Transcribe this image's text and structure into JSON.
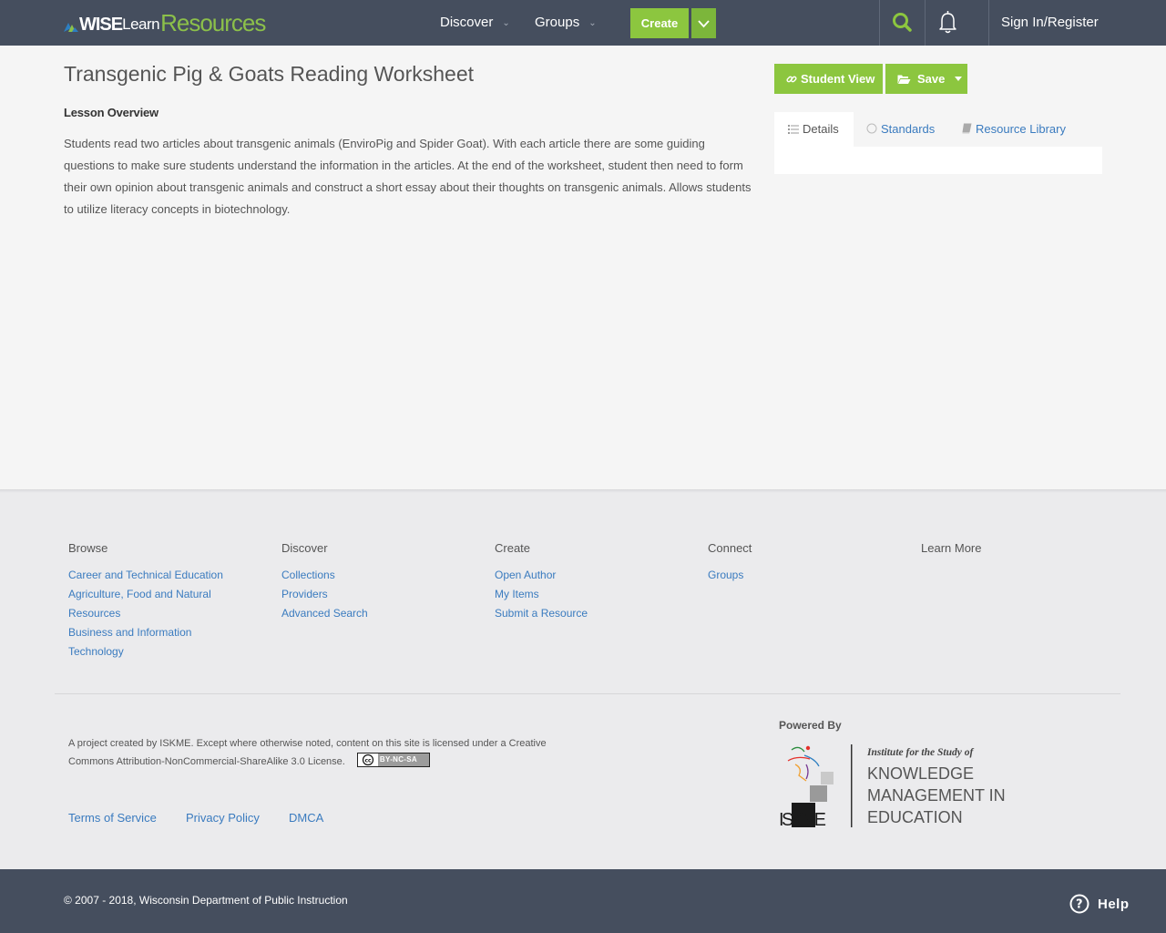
{
  "header": {
    "logo": {
      "part1": "WISE",
      "part2": "Learn",
      "part3": "Resources"
    },
    "nav": [
      {
        "label": "Discover"
      },
      {
        "label": "Groups"
      }
    ],
    "create_label": "Create",
    "signin_label": "Sign In/Register"
  },
  "resource": {
    "title": "Transgenic Pig & Goats Reading Worksheet",
    "overview_label": "Lesson Overview",
    "overview_text": "Students read two articles about transgenic animals (EnviroPig and Spider Goat).  With each article there are some guiding questions to make sure students understand the information in the articles.  At the end of the worksheet, student then need to form their own opinion about transgenic animals and construct a short essay about their thoughts on transgenic animals.  Allows students to utilize literacy concepts in biotechnology."
  },
  "actions": {
    "student_view_label": "Student View",
    "save_label": "Save"
  },
  "tabs": [
    {
      "label": "Details",
      "active": true
    },
    {
      "label": "Standards",
      "active": false
    },
    {
      "label": "Resource Library",
      "active": false
    }
  ],
  "footer": {
    "columns": [
      {
        "title": "Browse",
        "links": [
          "Career and Technical Education",
          "Agriculture, Food and Natural Resources",
          "Business and Information Technology"
        ]
      },
      {
        "title": "Discover",
        "links": [
          "Collections",
          "Providers",
          "Advanced Search"
        ]
      },
      {
        "title": "Create",
        "links": [
          "Open Author",
          "My Items",
          "Submit a Resource"
        ]
      },
      {
        "title": "Connect",
        "links": [
          "Groups"
        ]
      },
      {
        "title": "Learn More",
        "links": []
      }
    ],
    "license_text": "A project created by ISKME. Except where otherwise noted, content on this site is licensed under a Creative Commons Attribution-NonCommercial-ShareAlike 3.0 License.",
    "cc_badge_text": "BY-NC-SA",
    "legal_links": [
      "Terms of Service",
      "Privacy Policy",
      "DMCA"
    ],
    "powered_by_label": "Powered By",
    "iskme_logo": {
      "tagline": "Institute for the Study of",
      "line1": "KNOWLEDGE",
      "line2": "MANAGEMENT IN",
      "line3": "EDUCATION",
      "mark": "ISKME"
    },
    "copyright": "© 2007 - 2018, Wisconsin Department of Public Instruction",
    "help_label": "Help"
  },
  "colors": {
    "nav_bg": "#454e5e",
    "accent_green": "#8cc63f",
    "link_blue": "#3a7bbf",
    "logo_green": "#8cc04a"
  }
}
